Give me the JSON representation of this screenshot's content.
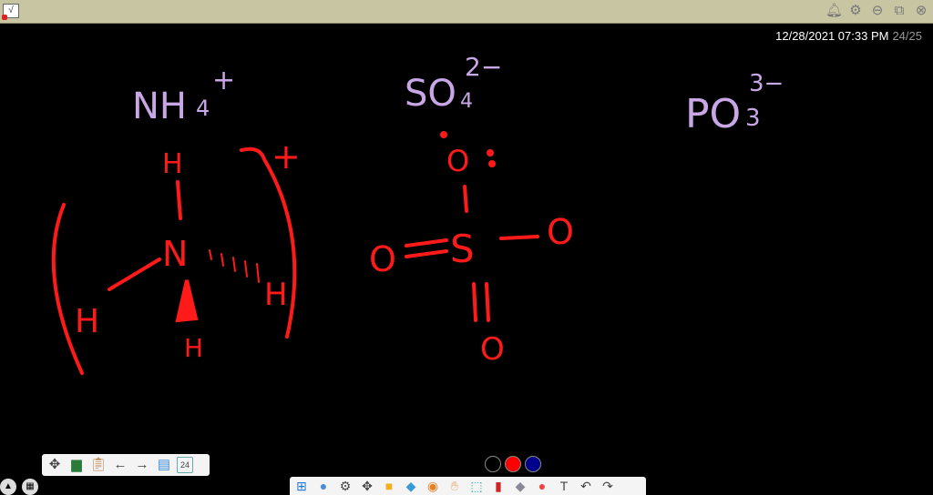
{
  "titlebar": {
    "icons": [
      "app-icon",
      "bell-icon",
      "gear-icon",
      "minimize-icon",
      "restore-icon",
      "close-icon"
    ]
  },
  "stamp": {
    "datetime": "12/28/2021 07:33 PM",
    "page": "24/25"
  },
  "board": {
    "ink_red": "#ff1a1a",
    "ink_lavender": "#c9a6e6",
    "nh4": {
      "formula": "NH",
      "sub": "4",
      "charge": "+",
      "atoms": {
        "top": "H",
        "center": "N",
        "left": "H",
        "right": "H",
        "bottom": "H"
      },
      "bracket_charge": "+"
    },
    "so4": {
      "formula": "SO",
      "sub": "4",
      "charge": "2−",
      "atoms": {
        "center": "S",
        "top": "O",
        "left": "O",
        "right": "O",
        "bottom": "O"
      }
    },
    "po3": {
      "formula": "PO",
      "sub": "3",
      "charge": "3−"
    }
  },
  "nav": {
    "page_label": "24"
  },
  "colors": [
    "#000000",
    "#ff0000",
    "#00008b"
  ]
}
